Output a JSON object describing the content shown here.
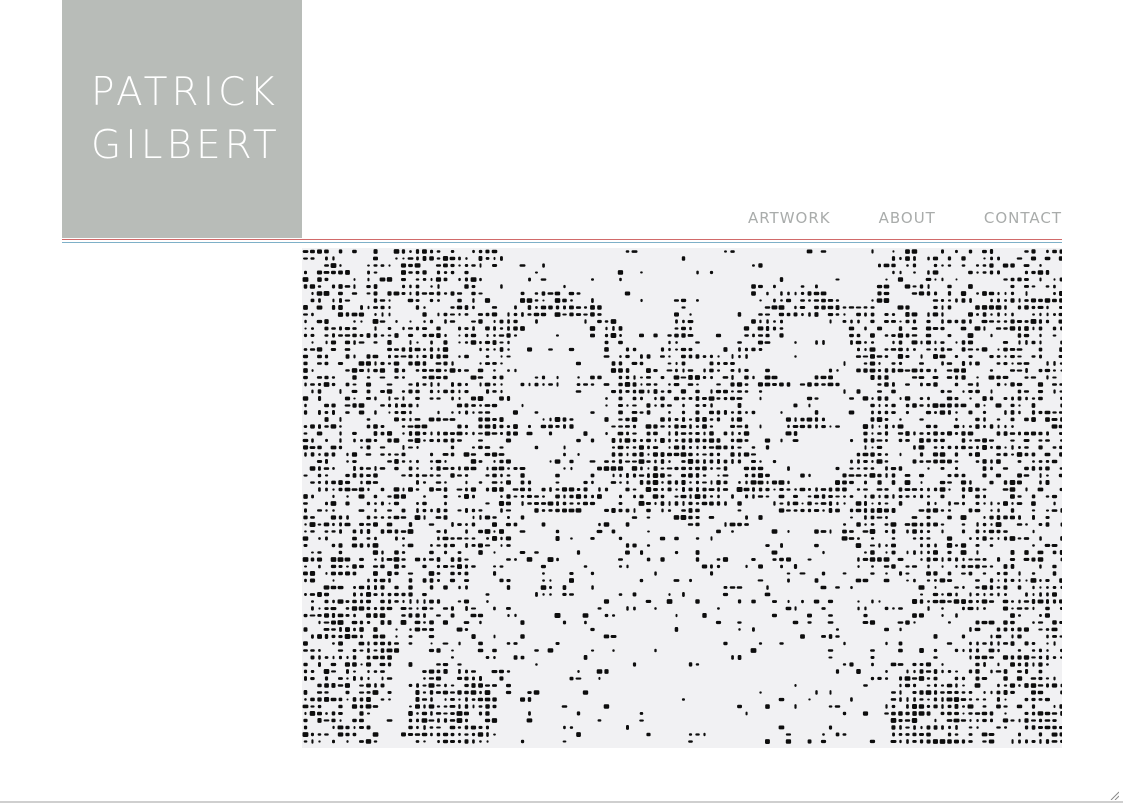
{
  "site": {
    "logo": {
      "line1": "PATRICK",
      "line2": "GILBERT"
    },
    "nav": {
      "artwork": "ARTWORK",
      "about": "ABOUT",
      "contact": "CONTACT"
    }
  },
  "colors": {
    "logo_bg": "#b8bcb8",
    "nav_text": "#a9acab",
    "rule_red": "#d16a6a",
    "rule_blue": "#7eb0c8"
  },
  "artwork": {
    "icon": "halftone-double-portrait-image"
  }
}
